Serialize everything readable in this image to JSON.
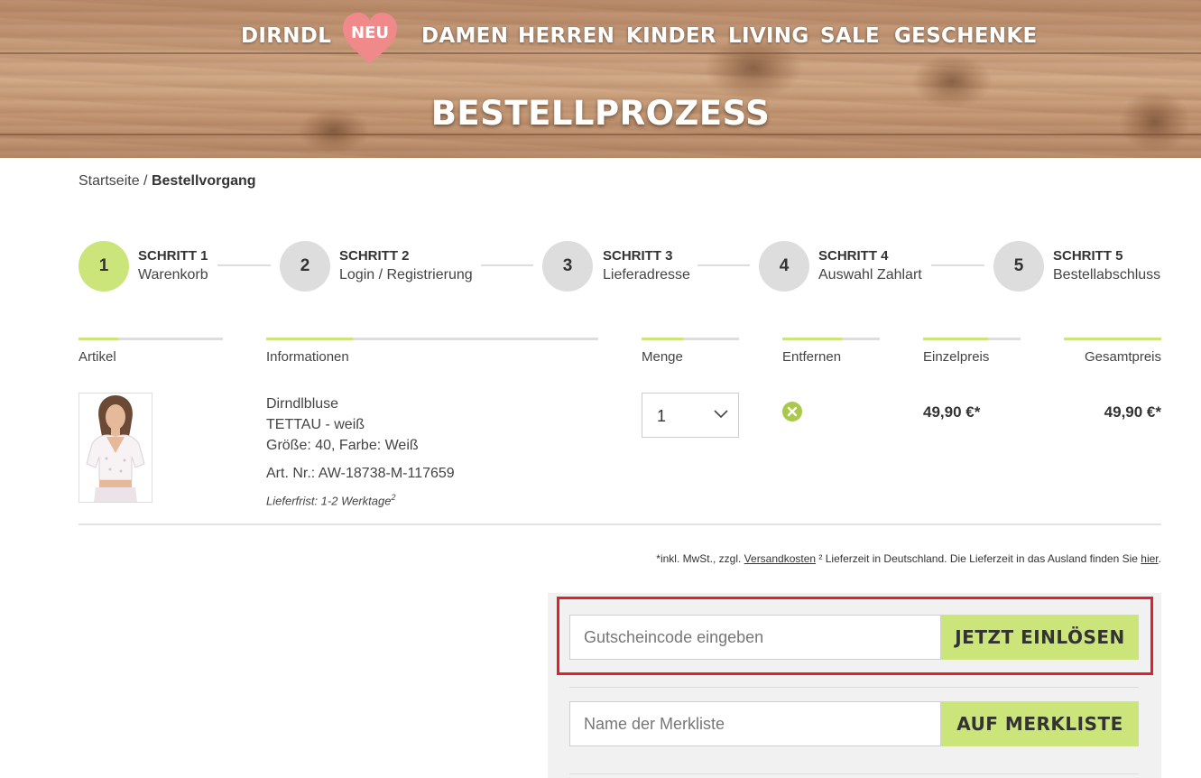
{
  "nav": {
    "items": [
      {
        "label": "DIRNDL"
      },
      {
        "label": "NEU"
      },
      {
        "label": "DAMEN"
      },
      {
        "label": "HERREN"
      },
      {
        "label": "KINDER"
      },
      {
        "label": "LIVING"
      },
      {
        "label": "SALE"
      },
      {
        "label": "GESCHENKE"
      }
    ]
  },
  "header": {
    "title": "BESTELLPROZESS"
  },
  "breadcrumb": {
    "home": "Startseite",
    "separator": "/",
    "current": "Bestellvorgang"
  },
  "steps": [
    {
      "number": "1",
      "title": "SCHRITT 1",
      "name": "Warenkorb",
      "active": true
    },
    {
      "number": "2",
      "title": "SCHRITT 2",
      "name": "Login / Registrierung",
      "active": false
    },
    {
      "number": "3",
      "title": "SCHRITT 3",
      "name": "Lieferadresse",
      "active": false
    },
    {
      "number": "4",
      "title": "SCHRITT 4",
      "name": "Auswahl Zahlart",
      "active": false
    },
    {
      "number": "5",
      "title": "SCHRITT 5",
      "name": "Bestellabschluss",
      "active": false
    }
  ],
  "table": {
    "columns": [
      "Artikel",
      "Informationen",
      "Menge",
      "Entfernen",
      "Einzelpreis",
      "Gesamtpreis"
    ]
  },
  "product": {
    "name": "Dirndlbluse",
    "variant": "TETTAU - weiß",
    "attributes": "Größe: 40, Farbe: Weiß",
    "article_number": "Art. Nr.: AW-18738-M-117659",
    "delivery": "Lieferfrist: 1-2 Werktage",
    "delivery_sup": "2",
    "quantity": "1",
    "unit_price": "49,90 €*",
    "total_price": "49,90 €*"
  },
  "footnote": {
    "prefix": "*inkl. MwSt., zzgl.",
    "shipping_link": "Versandkosten",
    "middle": "² Lieferzeit in Deutschland. Die Lieferzeit in das Ausland finden Sie",
    "here_link": "hier",
    "suffix": "."
  },
  "voucher": {
    "placeholder": "Gutscheincode eingeben",
    "button": "JETZT EINLÖSEN"
  },
  "wishlist": {
    "placeholder": "Name der Merkliste",
    "button": "AUF MERKLISTE"
  },
  "colors": {
    "accent": "#cce57a",
    "heart": "#f08a8a",
    "highlight": "#e0202b"
  },
  "icons": {
    "remove": "close-circle-icon",
    "dropdown": "chevron-down-icon",
    "neu_badge": "heart-icon"
  }
}
